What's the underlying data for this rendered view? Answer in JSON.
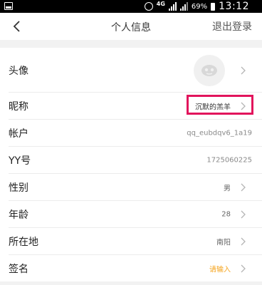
{
  "status_bar": {
    "network": "4G",
    "battery": "69%",
    "time": "13:12"
  },
  "nav": {
    "title": "个人信息",
    "logout": "退出登录"
  },
  "rows": {
    "avatar": {
      "label": "头像"
    },
    "nickname": {
      "label": "昵称",
      "value": "沉默的羔羊"
    },
    "account": {
      "label": "帐户",
      "value": "qq_eubdqv6_1a19"
    },
    "yy": {
      "label": "YY号",
      "value": "1725060225"
    },
    "gender": {
      "label": "性别",
      "value": "男"
    },
    "age": {
      "label": "年龄",
      "value": "28"
    },
    "location": {
      "label": "所在地",
      "value": "南阳"
    },
    "signature": {
      "label": "签名",
      "value": "请输入"
    }
  },
  "colors": {
    "highlight": "#e2145c",
    "placeholder": "#f5a623"
  }
}
